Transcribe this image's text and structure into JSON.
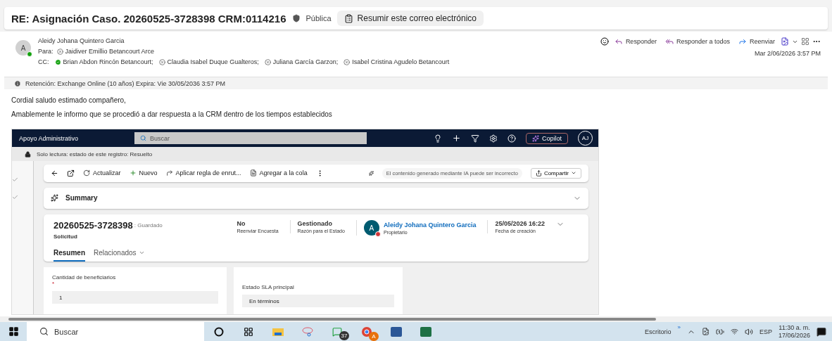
{
  "email": {
    "subject": "RE: Asignación Caso. 20260525-3728398 CRM:0114216",
    "sensitivity": "Pública",
    "summarize_button": "Resumir este correo electrónico",
    "sender": {
      "initial": "A",
      "name": "Aleidy Johana Quintero Garcia",
      "online": true
    },
    "to_label": "Para:",
    "to": [
      {
        "name": "Jaidiver Emillio Betancourt Arce",
        "available": false
      }
    ],
    "cc_label": "CC:",
    "cc": [
      {
        "name": "Brian Abdon Rincón Betancourt;",
        "available": true
      },
      {
        "name": "Claudia Isabel Duque Gualteros;",
        "available": false
      },
      {
        "name": "Juliana García Garzon;",
        "available": false
      },
      {
        "name": "Isabel Cristina Agudelo Betancourt",
        "available": false
      }
    ],
    "actions": [
      {
        "kind": "reply",
        "label": "Responder"
      },
      {
        "kind": "reply_all",
        "label": "Responder a todos"
      },
      {
        "kind": "forward",
        "label": "Reenviar"
      }
    ],
    "date": "Mar 2/06/2026 3:57 PM",
    "retention": "Retención: Exchange Online (10 años) Expira: Vie 30/05/2036 3:57 PM",
    "body": [
      "Cordial saludo estimado compañero,",
      "Amablemente le informo que se procedió a dar respuesta a la CRM dentro de los tiempos establecidos"
    ]
  },
  "crm": {
    "app_name": "Apoyo Administrativo",
    "search_placeholder": "Buscar",
    "copilot": "Copilot",
    "user_initials": "AJ",
    "readonly_notice": "Solo lectura: estado de este registro: Resuelto",
    "commands": [
      {
        "kind": "refresh",
        "label": "Actualizar"
      },
      {
        "kind": "new",
        "label": "Nuevo"
      },
      {
        "kind": "route",
        "label": "Aplicar regla de enrut..."
      },
      {
        "kind": "queue",
        "label": "Agregar a la cola"
      }
    ],
    "ai_notice": "El contenido generado mediante IA puede ser incorrecto",
    "share": "Compartir",
    "summary": "Summary",
    "record": {
      "title": "20260525-3728398",
      "status": ": Guardado",
      "type": "Solicitud",
      "fields": [
        {
          "value": "No",
          "label": "Reenviar Encuesta"
        },
        {
          "value": "Gestionado",
          "label": "Razón para el Estado"
        }
      ],
      "owner": {
        "initial": "A",
        "name": "Aleidy Johana Quintero Garcia",
        "label": "Propietario"
      },
      "created": {
        "value": "25/05/2026 16:22",
        "label": "Fecha de creación"
      }
    },
    "tabs": [
      {
        "label": "Resumen",
        "selected": true
      },
      {
        "label": "Relacionados",
        "selected": false
      }
    ],
    "left_field": {
      "label": "Cantidad de beneficiarios",
      "required_marker": "*",
      "value": "1"
    },
    "right_field": {
      "label": "Estado SLA principal",
      "value": "En términos"
    }
  },
  "taskbar": {
    "search": "Buscar",
    "whatsapp_badge": "37",
    "chrome_badge": "A",
    "desktop": "Escritorio",
    "overflow": "»",
    "language": "ESP",
    "time": "11:30 a. m.",
    "date": "17/06/2026"
  }
}
